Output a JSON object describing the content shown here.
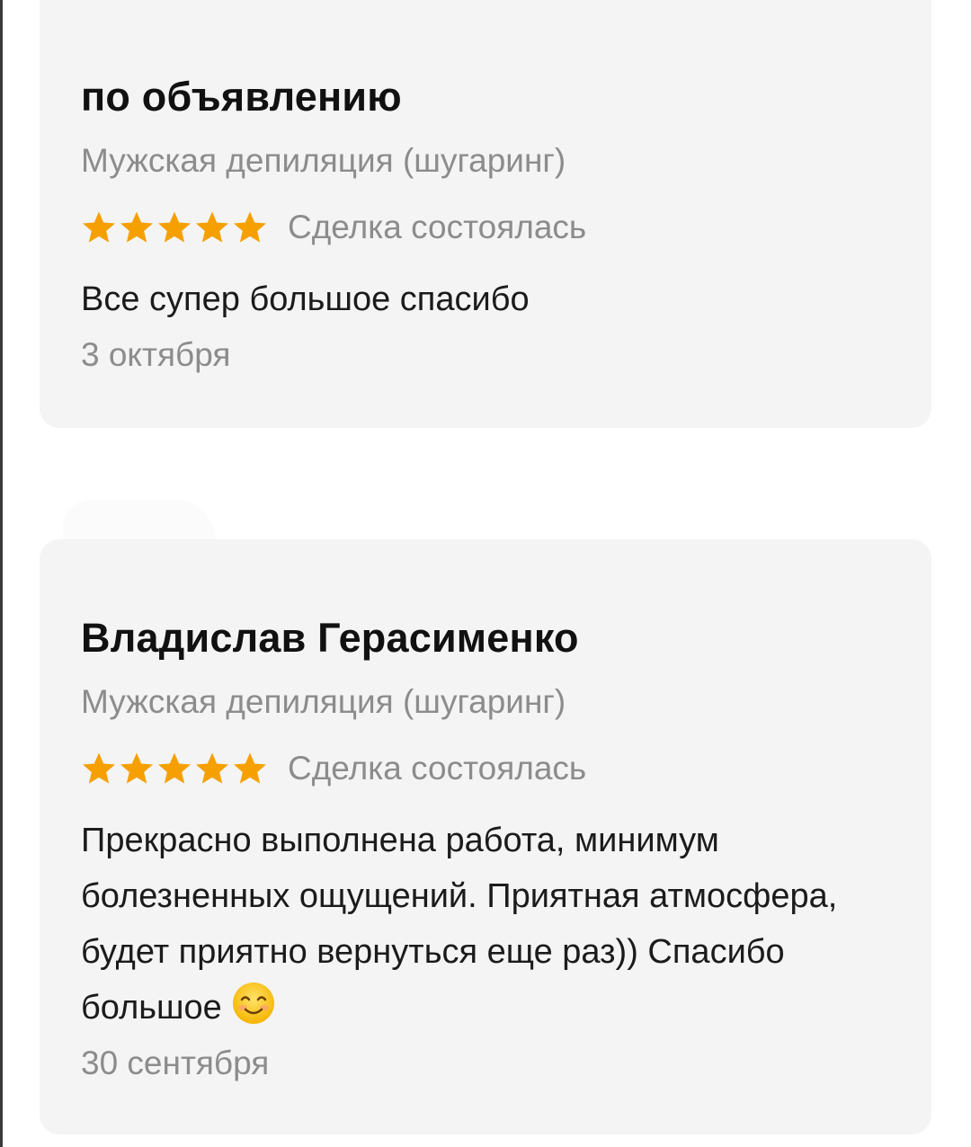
{
  "reviews": [
    {
      "author": "по объявлению",
      "service": "Мужская депиляция (шугаринг)",
      "rating": 5,
      "status": "Сделка состоялась",
      "text": "Все супер большое спасибо",
      "date": "3 октября"
    },
    {
      "author": "Владислав Герасименко",
      "service": "Мужская депиляция (шугаринг)",
      "rating": 5,
      "status": "Сделка состоялась",
      "text": "Прекрасно выполнена работа, минимум болезненных ощущений. Приятная атмосфера, будет приятно вернуться еще раз)) Спасибо большое",
      "emoji": "smiling-face-icon",
      "date": "30 сентября"
    }
  ],
  "colors": {
    "card_bg": "#f4f4f4",
    "star": "#f5a000",
    "muted_text": "#8c8c8c",
    "main_text": "#1b1b1b"
  }
}
